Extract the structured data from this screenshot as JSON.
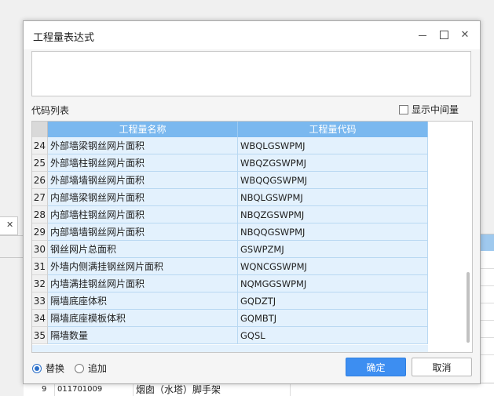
{
  "dialog": {
    "title": "工程量表达式",
    "expression_value": "",
    "list_label": "代码列表",
    "show_intermediate_label": "显示中间量",
    "show_intermediate_checked": false
  },
  "grid": {
    "columns": [
      "工程量名称",
      "工程量代码"
    ],
    "rows": [
      {
        "num": "24",
        "name": "外部墙梁钢丝网片面积",
        "code": "WBQLGSWPMJ"
      },
      {
        "num": "25",
        "name": "外部墙柱钢丝网片面积",
        "code": "WBQZGSWPMJ"
      },
      {
        "num": "26",
        "name": "外部墙墙钢丝网片面积",
        "code": "WBQQGSWPMJ"
      },
      {
        "num": "27",
        "name": "内部墙梁钢丝网片面积",
        "code": "NBQLGSWPMJ"
      },
      {
        "num": "28",
        "name": "内部墙柱钢丝网片面积",
        "code": "NBQZGSWPMJ"
      },
      {
        "num": "29",
        "name": "内部墙墙钢丝网片面积",
        "code": "NBQQGSWPMJ"
      },
      {
        "num": "30",
        "name": "钢丝网片总面积",
        "code": "GSWPZMJ"
      },
      {
        "num": "31",
        "name": "外墙内侧满挂钢丝网片面积",
        "code": "WQNCGSWPMJ"
      },
      {
        "num": "32",
        "name": "内墙满挂钢丝网片面积",
        "code": "NQMGGSWPMJ"
      },
      {
        "num": "33",
        "name": "隔墙底座体积",
        "code": "GQDZTJ"
      },
      {
        "num": "34",
        "name": "隔墙底座模板体积",
        "code": "GQMBTJ"
      },
      {
        "num": "35",
        "name": "隔墙数量",
        "code": "GQSL"
      }
    ]
  },
  "options": {
    "replace_label": "替换",
    "append_label": "追加",
    "selected": "replace"
  },
  "buttons": {
    "ok_label": "确定",
    "cancel_label": "取消"
  },
  "background": {
    "row_num": "9",
    "row_code": "011701009",
    "row_name": "烟囱（水塔）脚手架"
  },
  "colors": {
    "header_blue": "#7ab8ef",
    "row_fill": "#e3f1fd",
    "ok_button": "#3d8ef1",
    "radio_accent": "#2a6fc9"
  }
}
